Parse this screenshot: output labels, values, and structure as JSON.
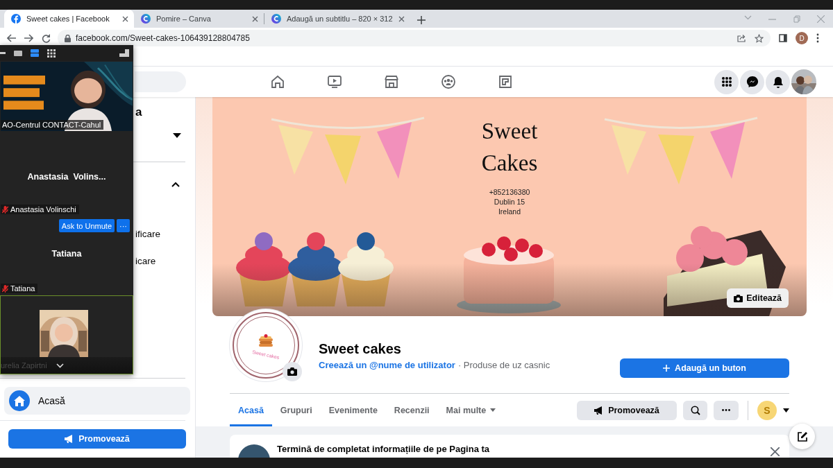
{
  "browser": {
    "tabs": [
      {
        "title": "Sweet cakes | Facebook",
        "selected": true,
        "kind": "facebook"
      },
      {
        "title": "Pomire – Canva",
        "selected": false,
        "kind": "canva"
      },
      {
        "title": "Adaugă un subtitlu – 820 × 312",
        "selected": false,
        "kind": "canva"
      }
    ],
    "url": "facebook.com/Sweet-cakes-106439128804785",
    "profile_initial": "D"
  },
  "zoom": {
    "tiles": [
      {
        "kind": "video",
        "label": "AO-Centrul CONTACT-Cahul",
        "muted": false,
        "active": false
      },
      {
        "kind": "name",
        "title": "Anastasia  Volins...",
        "label": "Anastasia Volinschi",
        "muted": true,
        "active": false,
        "button": "Ask to Unmute",
        "more_button": "···"
      },
      {
        "kind": "name",
        "title": "Tatiana",
        "label": "Tatiana",
        "muted": true,
        "active": false
      },
      {
        "label": "urelia Zapirtni",
        "muted": false,
        "active": true
      }
    ]
  },
  "sidebar": {
    "partial_title": "a",
    "partial_items": [
      "ificare",
      "icare"
    ],
    "items": [
      {
        "label": "Acasă",
        "selected": true
      }
    ],
    "promote_button": "Promovează"
  },
  "page": {
    "cover": {
      "title": "Sweet Cakes",
      "details": [
        "+852136380",
        "Dublin 15",
        "Ireland"
      ],
      "edit_button": "Editează"
    },
    "logo_text": "Sweet cakes",
    "name": "Sweet cakes",
    "username_link": "Creează un @nume de utilizator",
    "category": "· Produse de uz casnic",
    "add_button": "Adaugă un buton",
    "tabs": [
      {
        "label": "Acasă",
        "selected": true,
        "kind": "tab"
      },
      {
        "label": "Grupuri",
        "selected": false,
        "kind": "tab"
      },
      {
        "label": "Evenimente",
        "selected": false,
        "kind": "tab"
      },
      {
        "label": "Recenzii",
        "selected": false,
        "kind": "tab"
      },
      {
        "label": "Mai multe",
        "selected": false,
        "kind": "menu"
      }
    ],
    "promote_button": "Promovează",
    "page_initial": "S",
    "notice": {
      "title": "Termină de completat informațiile de pe Pagina ta"
    }
  }
}
